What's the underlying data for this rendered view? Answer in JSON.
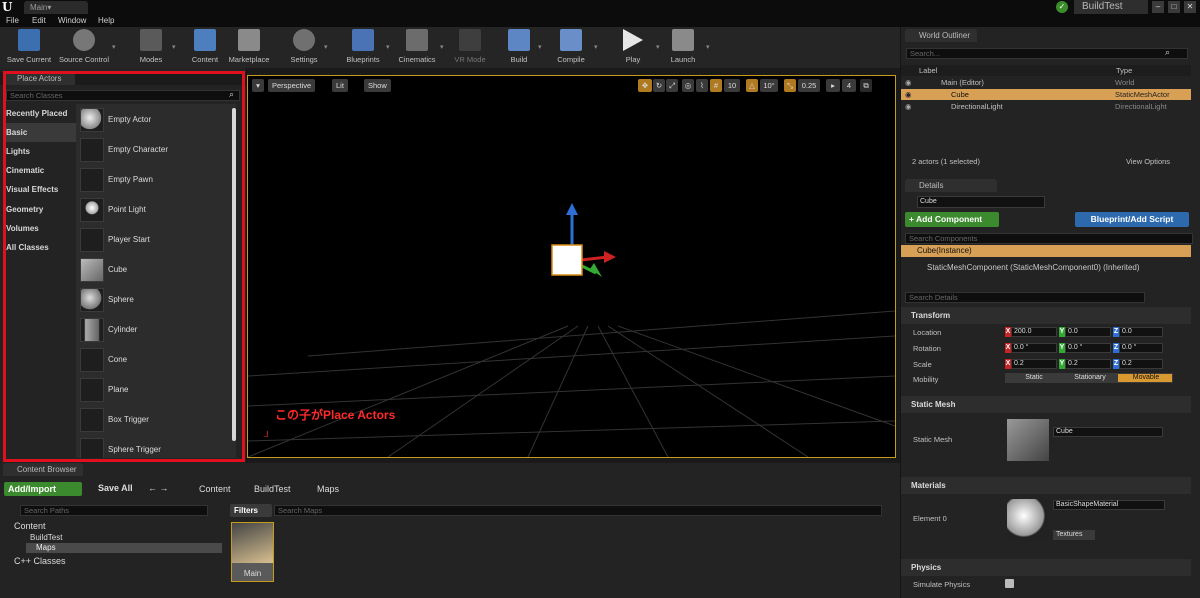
{
  "title_bar": {
    "logo": "U",
    "main_tab": "Main▾",
    "project": "BuildTest",
    "min": "–",
    "max": "□",
    "close": "✕"
  },
  "menu": [
    "File",
    "Edit",
    "Window",
    "Help"
  ],
  "toolbar": [
    {
      "label": "Save Current",
      "icon": "save-icon"
    },
    {
      "label": "Source Control",
      "icon": "source-control-icon"
    },
    {
      "label": "Modes",
      "icon": "modes-icon"
    },
    {
      "label": "Content",
      "icon": "content-icon"
    },
    {
      "label": "Marketplace",
      "icon": "marketplace-icon"
    },
    {
      "label": "Settings",
      "icon": "settings-icon"
    },
    {
      "label": "Blueprints",
      "icon": "blueprints-icon"
    },
    {
      "label": "Cinematics",
      "icon": "cinematics-icon"
    },
    {
      "label": "VR Mode",
      "icon": "vr-mode-icon"
    },
    {
      "label": "Build",
      "icon": "build-icon"
    },
    {
      "label": "Compile",
      "icon": "compile-icon"
    },
    {
      "label": "Play",
      "icon": "play-icon"
    },
    {
      "label": "Launch",
      "icon": "launch-icon"
    }
  ],
  "place_actors": {
    "tab": "Place Actors",
    "search_placeholder": "Search Classes",
    "categories": [
      "Recently Placed",
      "Basic",
      "Lights",
      "Cinematic",
      "Visual Effects",
      "Geometry",
      "Volumes",
      "All Classes"
    ],
    "selected_category": "Basic",
    "actors": [
      "Empty Actor",
      "Empty Character",
      "Empty Pawn",
      "Point Light",
      "Player Start",
      "Cube",
      "Sphere",
      "Cylinder",
      "Cone",
      "Plane",
      "Box Trigger",
      "Sphere Trigger"
    ]
  },
  "viewport": {
    "perspective": "Perspective",
    "lit": "Lit",
    "show": "Show",
    "grid_snap": "10",
    "rot_snap": "10°",
    "scale_snap": "0.25",
    "cam_speed": "4",
    "annotation": "この子がPlace Actors"
  },
  "outliner": {
    "tab": "World Outliner",
    "search_placeholder": "Search...",
    "col_label": "Label",
    "col_type": "Type",
    "rows": [
      {
        "label": "Main (Editor)",
        "type": "World"
      },
      {
        "label": "Cube",
        "type": "StaticMeshActor"
      },
      {
        "label": "DirectionalLight",
        "type": "DirectionalLight"
      }
    ],
    "status": "2 actors (1 selected)",
    "view_options": "View Options"
  },
  "details": {
    "tab": "Details",
    "name_value": "Cube",
    "add_component": "+ Add Component",
    "blueprint": "Blueprint/Add Script",
    "search_components": "Search Components",
    "instance": "Cube(Instance)",
    "component": "StaticMeshComponent (StaticMeshComponent0) (Inherited)",
    "search_details": "Search Details",
    "transform_section": "Transform",
    "location_label": "Location",
    "location": [
      "200.0",
      "0.0",
      "0.0"
    ],
    "rotation_label": "Rotation",
    "rotation": [
      "0.0 °",
      "0.0 °",
      "0.0 °"
    ],
    "scale_label": "Scale",
    "scale": [
      "0.2",
      "0.2",
      "0.2"
    ],
    "mobility_label": "Mobility",
    "mobility": [
      "Static",
      "Stationary",
      "Movable"
    ],
    "static_mesh_section": "Static Mesh",
    "static_mesh_label": "Static Mesh",
    "static_mesh_value": "Cube",
    "materials_section": "Materials",
    "element0_label": "Element 0",
    "material_value": "BasicShapeMaterial",
    "textures": "Textures",
    "physics_section": "Physics",
    "simulate_physics": "Simulate Physics"
  },
  "content_browser": {
    "tab": "Content Browser",
    "add_import": "Add/Import",
    "save_all": "Save All",
    "path": [
      "Content",
      "BuildTest",
      "Maps"
    ],
    "search_paths": "Search Paths",
    "filters": "Filters",
    "search_maps": "Search Maps",
    "tree": [
      "Content",
      "BuildTest",
      "Maps",
      "C++ Classes"
    ],
    "asset": "Main"
  }
}
